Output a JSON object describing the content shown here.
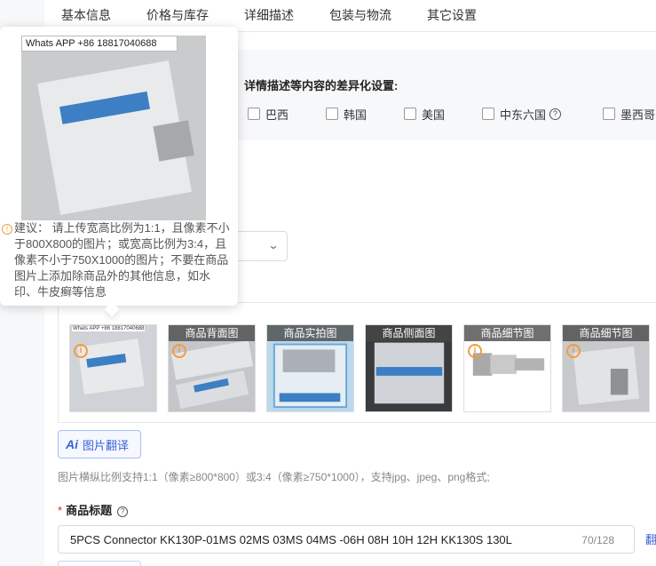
{
  "tabs": [
    "基本信息",
    "价格与库存",
    "详细描述",
    "包装与物流",
    "其它设置"
  ],
  "region": {
    "title": "详情描述等内容的差异化设置:",
    "options": [
      "巴西",
      "韩国",
      "美国",
      "中东六国",
      "墨西哥"
    ]
  },
  "images": {
    "labels": [
      "",
      "商品背面图",
      "商品实拍图",
      "商品侧面图",
      "商品细节图",
      "商品细节图"
    ],
    "first_watermark": "Whats APP +86 18817040688",
    "translate_button": "图片翻译",
    "translate_icon_text": "Ai",
    "hint": "图片横纵比例支持1:1（像素≥800*800）或3:4（像素≥750*1000），支持jpg、jpeg、png格式;"
  },
  "tooltip": {
    "watermark": "Whats APP +86 18817040688",
    "advice": "建议：  请上传宽高比例为1:1，且像素不小于800X800的图片；或宽高比例为3:4，且像素不小于750X1000的图片；不要在商品图片上添加除商品外的其他信息，如水印、牛皮癣等信息"
  },
  "product_title": {
    "required_mark": "*",
    "label": "商品标题",
    "value": "5PCS Connector KK130P-01MS 02MS 03MS 04MS -06H 08H 10H 12H KK130S 130L",
    "count": "70/128",
    "edge_link": "翻"
  },
  "colors": {
    "accent": "#3a62d7",
    "warning": "#f39c3c",
    "required": "#e02020"
  },
  "icons": {
    "help": "question-circle-icon",
    "warning": "exclamation-circle-icon",
    "dropdown": "chevron-down-icon"
  }
}
